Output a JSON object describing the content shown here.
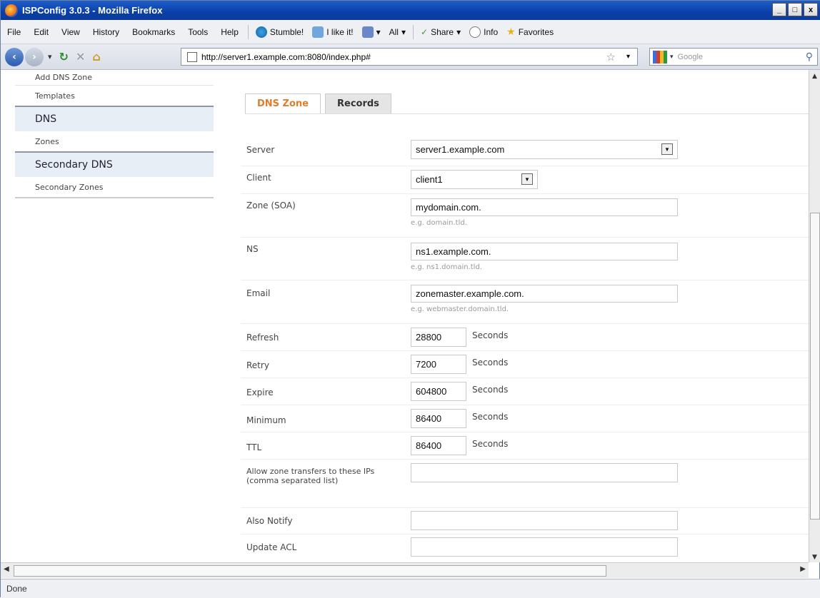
{
  "window": {
    "title": "ISPConfig 3.0.3 - Mozilla Firefox",
    "min": "_",
    "max": "□",
    "close": "x"
  },
  "menu": [
    "File",
    "Edit",
    "View",
    "History",
    "Bookmarks",
    "Tools",
    "Help"
  ],
  "toolbar": {
    "stumble": "Stumble!",
    "like": "I like it!",
    "all": "All",
    "share": "Share",
    "info": "Info",
    "favorites": "Favorites"
  },
  "nav": {
    "url": "http://server1.example.com:8080/index.php#",
    "search_placeholder": "Google"
  },
  "sidebar": {
    "items_top": [
      "Add DNS Zone",
      "Templates"
    ],
    "dns_head": "DNS",
    "dns_items": [
      "Zones"
    ],
    "secondary_head": "Secondary DNS",
    "secondary_items": [
      "Secondary Zones"
    ]
  },
  "tabs": [
    "DNS Zone",
    "Records"
  ],
  "form": {
    "server": {
      "label": "Server",
      "value": "server1.example.com"
    },
    "client": {
      "label": "Client",
      "value": "client1"
    },
    "zone": {
      "label": "Zone (SOA)",
      "value": "mydomain.com.",
      "hint": "e.g. domain.tld."
    },
    "ns": {
      "label": "NS",
      "value": "ns1.example.com.",
      "hint": "e.g. ns1.domain.tld."
    },
    "email": {
      "label": "Email",
      "value": "zonemaster.example.com.",
      "hint": "e.g. webmaster.domain.tld."
    },
    "refresh": {
      "label": "Refresh",
      "value": "28800",
      "unit": "Seconds"
    },
    "retry": {
      "label": "Retry",
      "value": "7200",
      "unit": "Seconds"
    },
    "expire": {
      "label": "Expire",
      "value": "604800",
      "unit": "Seconds"
    },
    "minimum": {
      "label": "Minimum",
      "value": "86400",
      "unit": "Seconds"
    },
    "ttl": {
      "label": "TTL",
      "value": "86400",
      "unit": "Seconds"
    },
    "xfer": {
      "label": "Allow zone transfers to these IPs (comma separated list)",
      "value": ""
    },
    "notify": {
      "label": "Also Notify",
      "value": ""
    },
    "acl": {
      "label": "Update ACL",
      "value": ""
    }
  },
  "status": "Done"
}
